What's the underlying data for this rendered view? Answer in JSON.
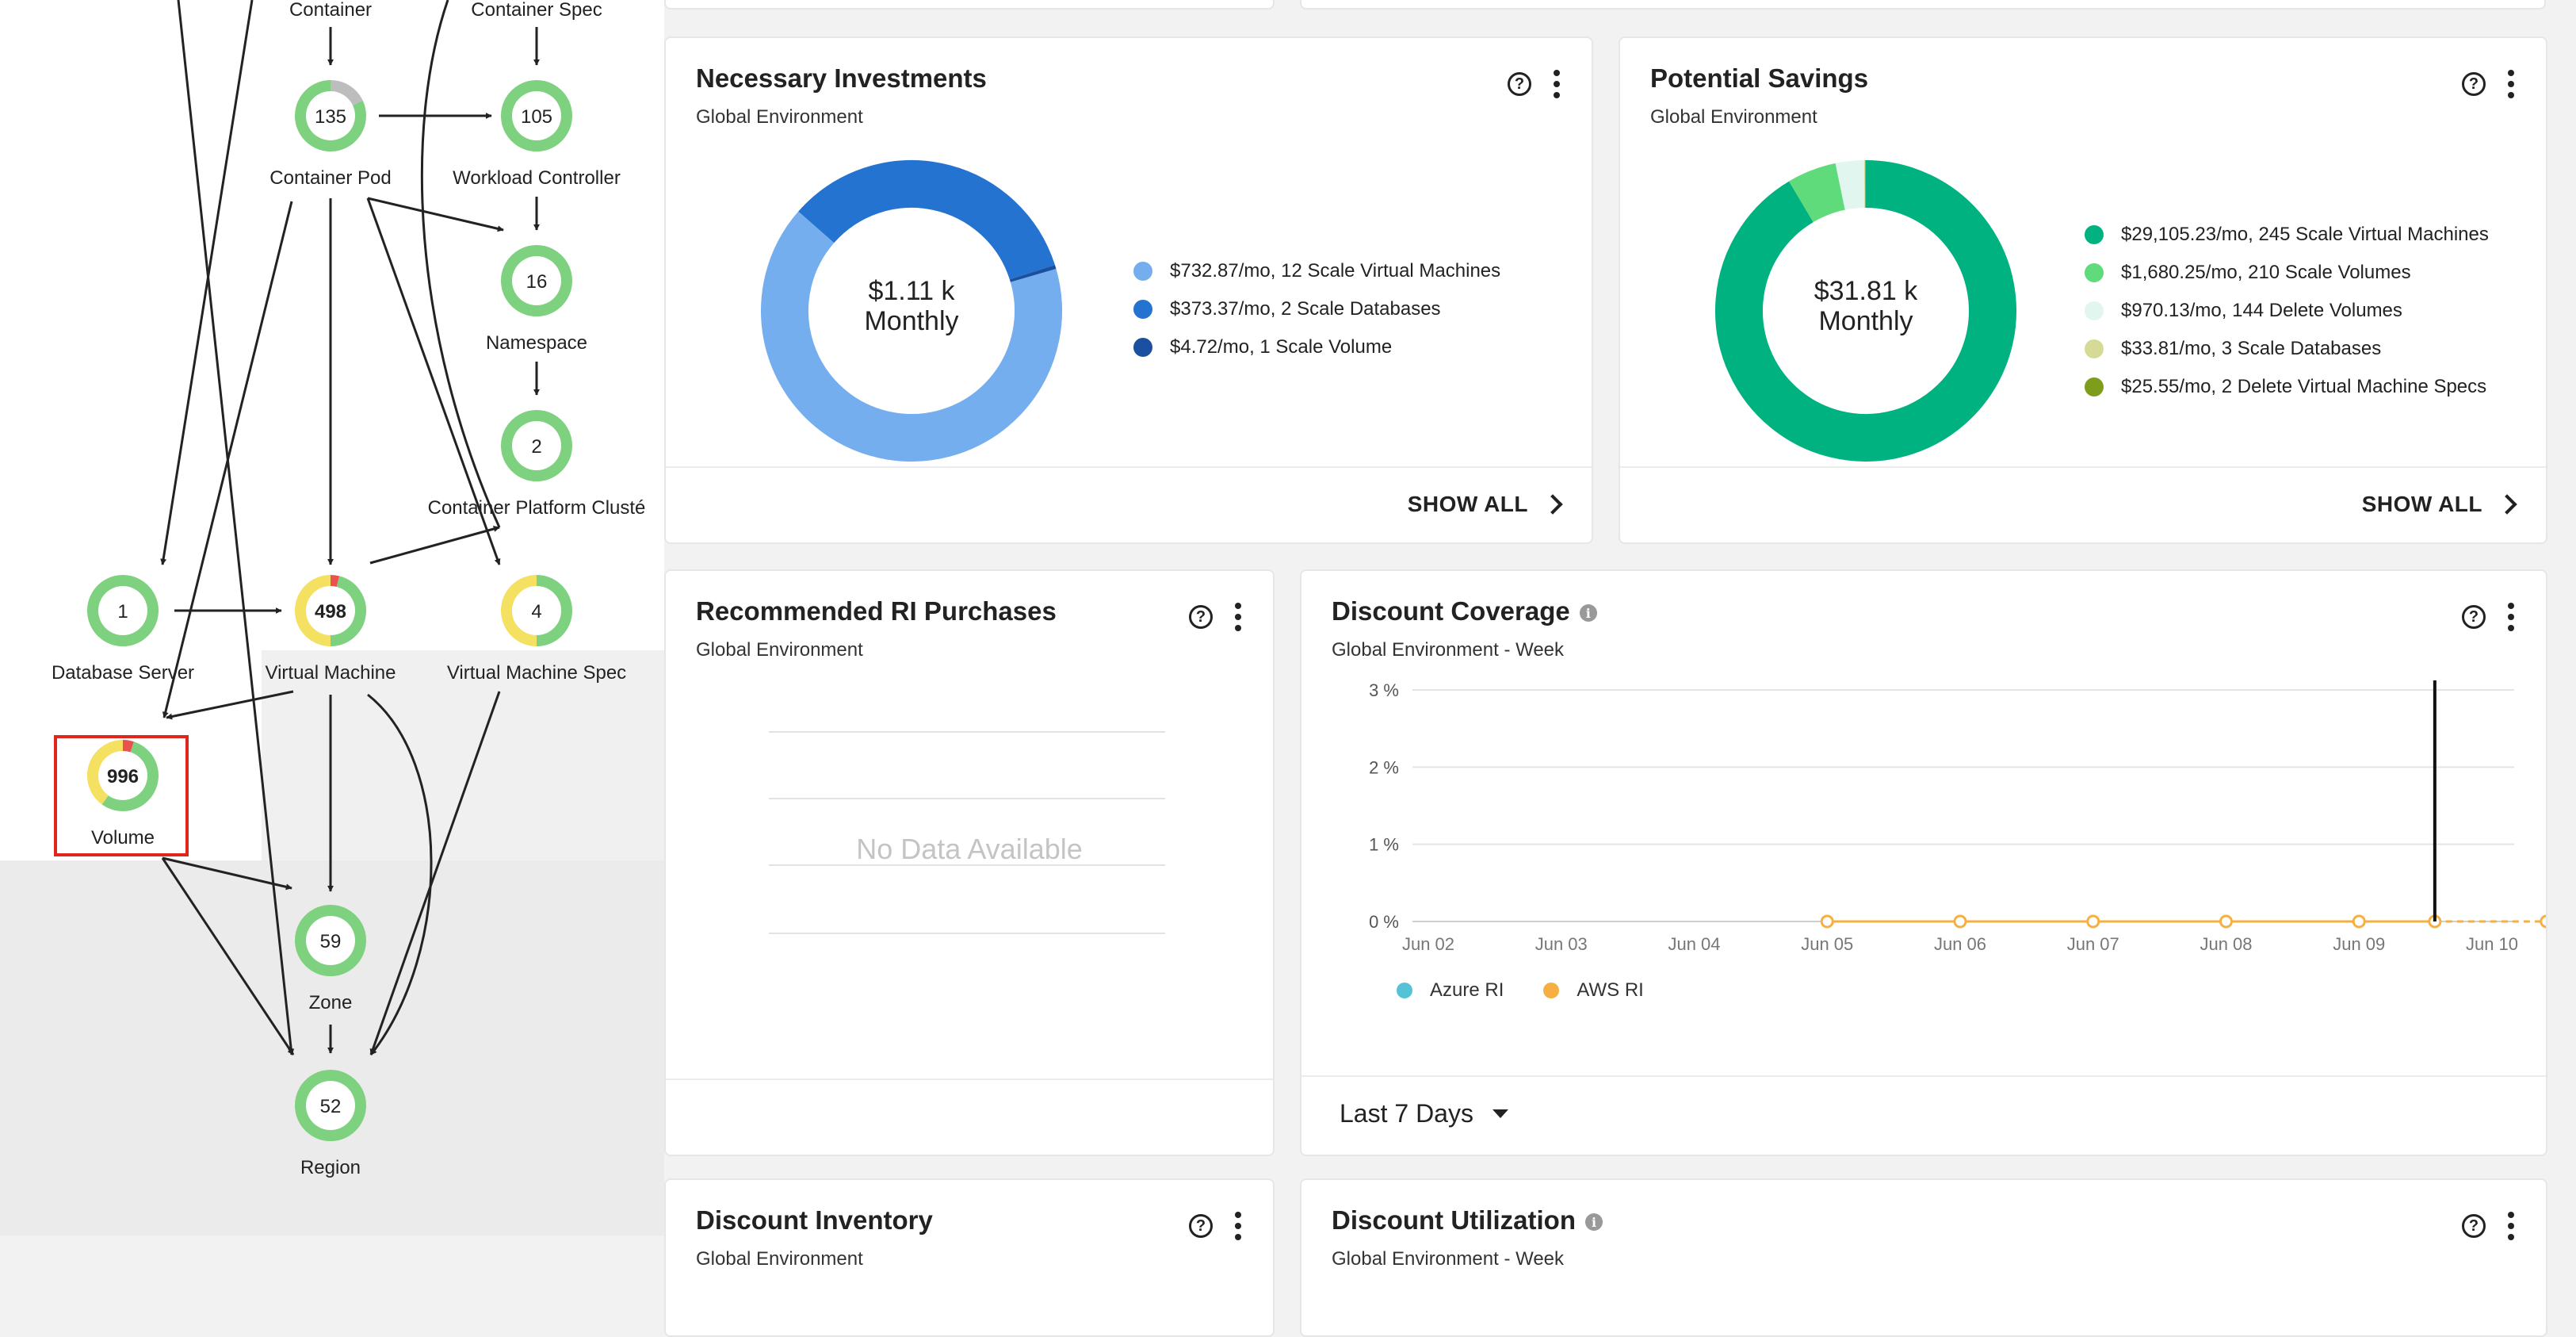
{
  "topology": {
    "nodes": [
      {
        "id": "container",
        "label": "Container",
        "count": ""
      },
      {
        "id": "container-spec",
        "label": "Container Spec",
        "count": ""
      },
      {
        "id": "container-pod",
        "label": "Container Pod",
        "count": "135"
      },
      {
        "id": "workload-controller",
        "label": "Workload Controller",
        "count": "105"
      },
      {
        "id": "namespace",
        "label": "Namespace",
        "count": "16"
      },
      {
        "id": "container-platform-cluster",
        "label": "Container Platform Clusté",
        "count": "2"
      },
      {
        "id": "database-server",
        "label": "Database Server",
        "count": "1"
      },
      {
        "id": "virtual-machine",
        "label": "Virtual Machine",
        "count": "498"
      },
      {
        "id": "virtual-machine-spec",
        "label": "Virtual Machine Spec",
        "count": "4"
      },
      {
        "id": "volume",
        "label": "Volume",
        "count": "996"
      },
      {
        "id": "zone",
        "label": "Zone",
        "count": "59"
      },
      {
        "id": "region",
        "label": "Region",
        "count": "52"
      }
    ]
  },
  "necessary_investments": {
    "title": "Necessary Investments",
    "subtitle": "Global Environment",
    "center_value": "$1.11 k",
    "center_unit": "Monthly",
    "footer_action": "SHOW ALL",
    "legend": [
      {
        "label": "$732.87/mo, 12 Scale Virtual Machines",
        "color": "#74aeee"
      },
      {
        "label": "$373.37/mo, 2 Scale Databases",
        "color": "#2573d0"
      },
      {
        "label": "$4.72/mo, 1 Scale Volume",
        "color": "#1b4fa0"
      }
    ]
  },
  "potential_savings": {
    "title": "Potential Savings",
    "subtitle": "Global Environment",
    "center_value": "$31.81 k",
    "center_unit": "Monthly",
    "footer_action": "SHOW ALL",
    "legend": [
      {
        "label": "$29,105.23/mo, 245 Scale Virtual Machines",
        "color": "#00b27f"
      },
      {
        "label": "$1,680.25/mo, 210 Scale Volumes",
        "color": "#5fdb7c"
      },
      {
        "label": "$970.13/mo, 144 Delete Volumes",
        "color": "#e1f6ee"
      },
      {
        "label": "$33.81/mo, 3 Scale Databases",
        "color": "#d5db96"
      },
      {
        "label": "$25.55/mo, 2 Delete Virtual Machine Specs",
        "color": "#7e9d1c"
      }
    ]
  },
  "recommended_ri": {
    "title": "Recommended RI Purchases",
    "subtitle": "Global Environment",
    "empty_text": "No Data Available"
  },
  "discount_coverage": {
    "title": "Discount Coverage",
    "subtitle": "Global Environment - Week",
    "range_label": "Last 7 Days"
  },
  "discount_inventory": {
    "title": "Discount Inventory",
    "subtitle": "Global Environment"
  },
  "discount_utilization": {
    "title": "Discount Utilization",
    "subtitle": "Global Environment - Week"
  },
  "chart_data": [
    {
      "type": "pie",
      "title": "Necessary Investments",
      "categories": [
        "12 Scale Virtual Machines",
        "2 Scale Databases",
        "1 Scale Volume"
      ],
      "values": [
        732.87,
        373.37,
        4.72
      ],
      "colors": [
        "#74aeee",
        "#2573d0",
        "#1b4fa0"
      ]
    },
    {
      "type": "pie",
      "title": "Potential Savings",
      "categories": [
        "245 Scale Virtual Machines",
        "210 Scale Volumes",
        "144 Delete Volumes",
        "3 Scale Databases",
        "2 Delete Virtual Machine Specs"
      ],
      "values": [
        29105.23,
        1680.25,
        970.13,
        33.81,
        25.55
      ],
      "colors": [
        "#00b27f",
        "#5fdb7c",
        "#e1f6ee",
        "#d5db96",
        "#7e9d1c"
      ]
    },
    {
      "type": "line",
      "title": "Discount Coverage",
      "categories": [
        "Jun 02",
        "Jun 03",
        "Jun 04",
        "Jun 05",
        "Jun 06",
        "Jun 07",
        "Jun 08",
        "Jun 09",
        "Jun 10"
      ],
      "yticks": [
        "0 %",
        "1 %",
        "2 %",
        "3 %"
      ],
      "ylim": [
        0,
        3
      ],
      "grid": true,
      "legend_position": "bottom-left",
      "series": [
        {
          "name": "Azure RI",
          "color": "#55c3d6",
          "x": [],
          "y": []
        },
        {
          "name": "AWS RI",
          "color": "#f5b041",
          "x": [
            3,
            4,
            5,
            6,
            7,
            7.57,
            8.41
          ],
          "y": [
            0,
            0,
            0,
            0,
            0,
            0,
            0
          ]
        }
      ],
      "marker_line_x": 7.57
    }
  ]
}
